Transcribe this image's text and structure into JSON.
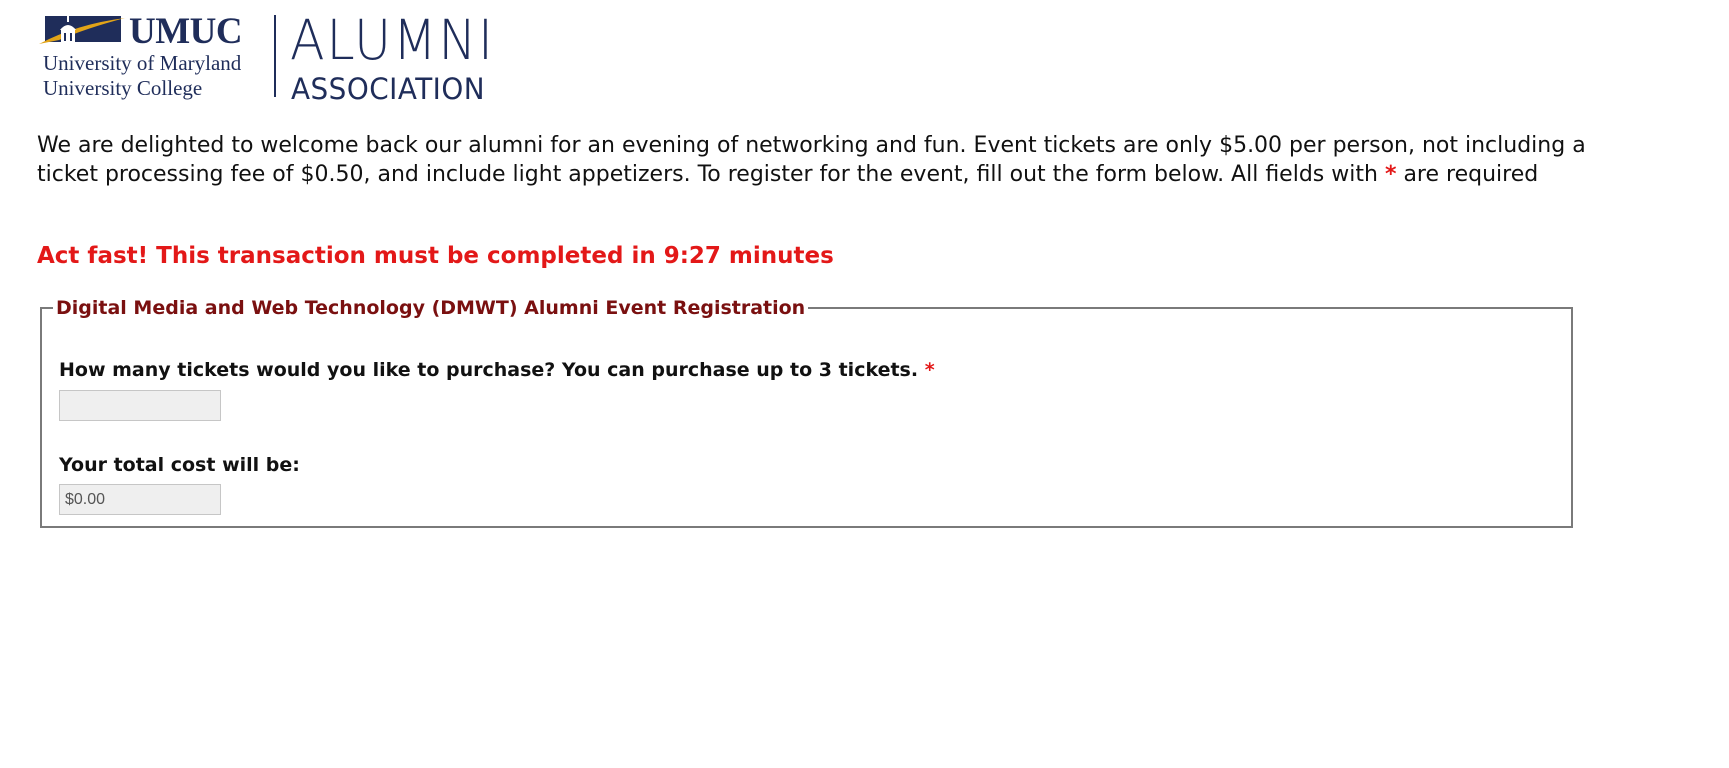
{
  "logo": {
    "brand": "UMUC",
    "university_line1": "University of Maryland",
    "university_line2": "University College",
    "alumni": "ALUMNI",
    "association": "ASSOCIATION"
  },
  "intro": {
    "text": "We are delighted to welcome back our alumni for an evening of networking and fun. Event tickets are only $5.00 per person, not including a ticket processing fee of $0.50, and include light appetizers. To register for the event, fill out the form below. All fields with",
    "star": "*",
    "suffix": "are required"
  },
  "timer": {
    "text": "Act fast! This transaction must be completed in 9:27 minutes"
  },
  "form": {
    "legend": "Digital Media and Web Technology (DMWT) Alumni Event Registration",
    "tickets_label": "How many tickets would you like to purchase? You can purchase up to 3 tickets.",
    "required_star": "*",
    "tickets_value": "",
    "total_label": "Your total cost will be:",
    "total_value": "$0.00"
  },
  "colors": {
    "brand_navy": "#1f2d5a",
    "logo_gold": "#e2a418",
    "required_red": "#e31818",
    "legend_maroon": "#7a1010"
  }
}
